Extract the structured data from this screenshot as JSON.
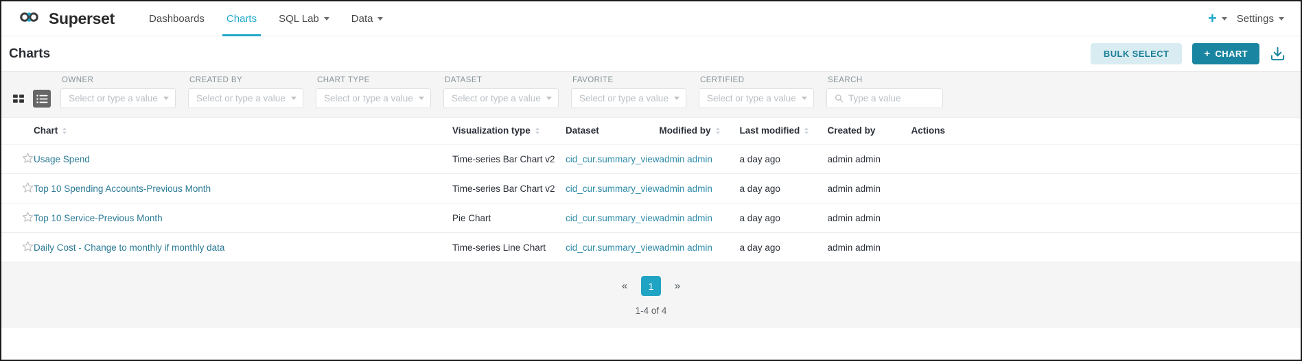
{
  "navbar": {
    "brand": "Superset",
    "brand_logo_icon": "superset-infinity-logo",
    "items": [
      {
        "label": "Dashboards",
        "active": false,
        "has_caret": false
      },
      {
        "label": "Charts",
        "active": true,
        "has_caret": false
      },
      {
        "label": "SQL Lab",
        "active": false,
        "has_caret": true
      },
      {
        "label": "Data",
        "active": false,
        "has_caret": true
      }
    ],
    "plus_label": "+",
    "plus_icon": "plus-icon",
    "settings_label": "Settings"
  },
  "header": {
    "title": "Charts",
    "bulk_select_label": "BULK SELECT",
    "new_chart_label": "CHART",
    "new_chart_plus": "+",
    "import_icon": "import-download-icon"
  },
  "view_toggle": {
    "grid_icon": "grid-view-icon",
    "list_icon": "list-view-icon",
    "selected": "list"
  },
  "filters": [
    {
      "label": "OWNER",
      "placeholder": "Select or type a value",
      "value": "",
      "name": "owner"
    },
    {
      "label": "CREATED BY",
      "placeholder": "Select or type a value",
      "value": "",
      "name": "created-by"
    },
    {
      "label": "CHART TYPE",
      "placeholder": "Select or type a value",
      "value": "",
      "name": "chart-type"
    },
    {
      "label": "DATASET",
      "placeholder": "Select or type a value",
      "value": "",
      "name": "dataset"
    },
    {
      "label": "FAVORITE",
      "placeholder": "Select or type a value",
      "value": "",
      "name": "favorite"
    },
    {
      "label": "CERTIFIED",
      "placeholder": "Select or type a value",
      "value": "",
      "name": "certified"
    }
  ],
  "search": {
    "label": "SEARCH",
    "placeholder": "Type a value",
    "value": "",
    "icon": "search-icon"
  },
  "table": {
    "columns": [
      {
        "label": "Chart",
        "sortable": true
      },
      {
        "label": "Visualization type",
        "sortable": true
      },
      {
        "label": "Dataset",
        "sortable": false
      },
      {
        "label": "Modified by",
        "sortable": true
      },
      {
        "label": "Last modified",
        "sortable": true
      },
      {
        "label": "Created by",
        "sortable": false
      },
      {
        "label": "Actions",
        "sortable": false
      }
    ],
    "rows": [
      {
        "favorite": false,
        "chart": "Usage Spend",
        "viz_type": "Time-series Bar Chart v2",
        "dataset": "cid_cur.summary_view",
        "modified_by": "admin admin",
        "last_modified": "a day ago",
        "created_by": "admin admin"
      },
      {
        "favorite": false,
        "chart": "Top 10 Spending Accounts-Previous Month",
        "viz_type": "Time-series Bar Chart v2",
        "dataset": "cid_cur.summary_view",
        "modified_by": "admin admin",
        "last_modified": "a day ago",
        "created_by": "admin admin"
      },
      {
        "favorite": false,
        "chart": "Top 10 Service-Previous Month",
        "viz_type": "Pie Chart",
        "dataset": "cid_cur.summary_view",
        "modified_by": "admin admin",
        "last_modified": "a day ago",
        "created_by": "admin admin"
      },
      {
        "favorite": false,
        "chart": "Daily Cost - Change to monthly if monthly data",
        "viz_type": "Time-series Line Chart",
        "dataset": "cid_cur.summary_view",
        "modified_by": "admin admin",
        "last_modified": "a day ago",
        "created_by": "admin admin"
      }
    ]
  },
  "pagination": {
    "prev_label": "«",
    "next_label": "»",
    "current_page": "1",
    "row_count_text": "1-4 of 4"
  },
  "colors": {
    "accent": "#1fa8c9",
    "primary_button": "#1a85a0",
    "secondary_button_bg": "#d9ecf2",
    "link": "#2b7a96",
    "filter_bar_bg": "#f5f5f5",
    "page_active": "#21a3c4"
  }
}
